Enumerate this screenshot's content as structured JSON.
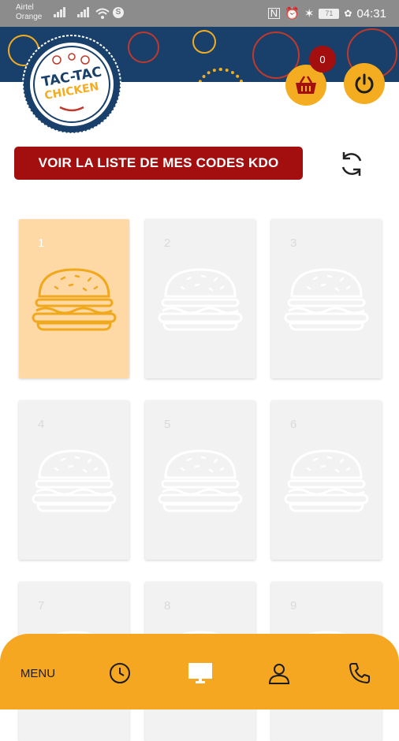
{
  "status_bar": {
    "carrier_line1": "Airtel",
    "carrier_line2": "Orange",
    "battery": "71",
    "time": "04:31"
  },
  "header": {
    "logo_text_top": "TAC-TAC",
    "logo_text_bottom": "CHICKEN",
    "cart_count": "0",
    "cart_icon": "basket-icon",
    "logout_icon": "power-icon"
  },
  "actions": {
    "codes_button": "VOIR LA LISTE DE MES CODES KDO",
    "refresh_icon": "refresh-icon"
  },
  "cards": [
    {
      "number": "1",
      "active": true
    },
    {
      "number": "2",
      "active": false
    },
    {
      "number": "3",
      "active": false
    },
    {
      "number": "4",
      "active": false
    },
    {
      "number": "5",
      "active": false
    },
    {
      "number": "6",
      "active": false
    },
    {
      "number": "7",
      "active": false
    },
    {
      "number": "8",
      "active": false
    },
    {
      "number": "9",
      "active": false
    }
  ],
  "bottom_nav": {
    "menu_label": "MENU",
    "items": [
      "clock-icon",
      "monitor-icon",
      "user-icon",
      "phone-icon"
    ]
  },
  "colors": {
    "brand_blue": "#18406a",
    "brand_red": "#a30f0f",
    "accent_orange": "#f6a722",
    "active_card": "#fed9a6",
    "inactive_card": "#f2f2f2"
  }
}
